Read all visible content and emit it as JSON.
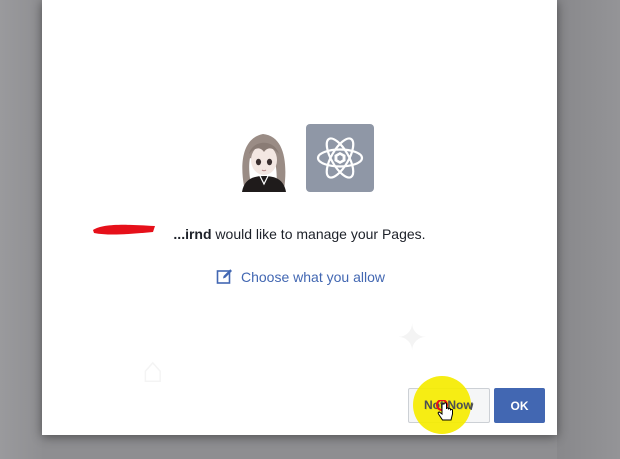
{
  "dialog": {
    "message_name": "...irnd",
    "message_text": " would like to manage your Pages.",
    "choose_link": "Choose what you allow"
  },
  "buttons": {
    "not_now": "Not Now",
    "ok": "OK"
  },
  "icons": {
    "user_avatar": "user-profile-picture",
    "app_icon": "atom-app-icon",
    "choose_icon": "edit-square-icon",
    "cursor": "hand-pointer-cursor"
  },
  "colors": {
    "link": "#4267b2",
    "primary_button": "#4267b2",
    "click_highlight": "#f5ec00",
    "app_icon_bg": "#8f97a6"
  }
}
